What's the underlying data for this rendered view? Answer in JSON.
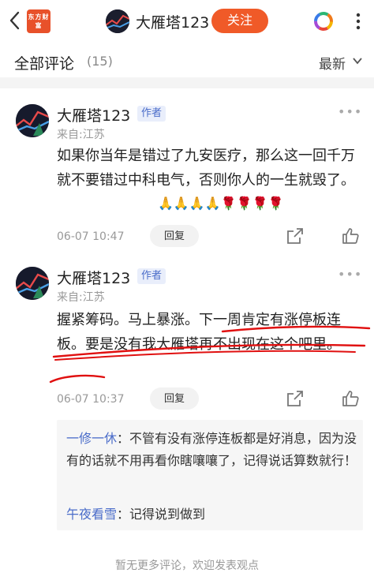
{
  "nav": {
    "logo_text": "东方财富",
    "title": "大雁塔123",
    "follow_label": "关注"
  },
  "comments_header": {
    "title": "全部评论",
    "count": "(15)",
    "sort_label": "最新"
  },
  "comments": [
    {
      "name": "大雁塔123",
      "tag": "作者",
      "region": "来自:江苏",
      "text": "如果你当年是错过了九安医疗，那么这一回千万就不要错过中科电气，否则你人的一生就毁了。",
      "emojis": "🙏🙏🙏🙏🌹🌹🌹🌹",
      "time": "06-07 10:47",
      "reply_label": "回复"
    },
    {
      "name": "大雁塔123",
      "tag": "作者",
      "region": "来自:江苏",
      "text": "握紧筹码。马上暴涨。下一周肯定有涨停板连板。要是没有我大雁塔再不出现在这个吧里。",
      "time": "06-07 10:37",
      "reply_label": "回复",
      "replies": [
        {
          "user": "一修一休",
          "text": "不管有没有涨停连板都是好消息，因为没有的话就不用再看你瞎嚷嚷了，记得说话算数就行！"
        },
        {
          "user": "午夜看雪",
          "text": "记得说到做到"
        }
      ]
    }
  ],
  "footer": {
    "note": "暂无更多评论，欢迎发表观点"
  },
  "colors": {
    "accent": "#f05a28",
    "link": "#4a6cc9",
    "annotation": "#e01010"
  }
}
